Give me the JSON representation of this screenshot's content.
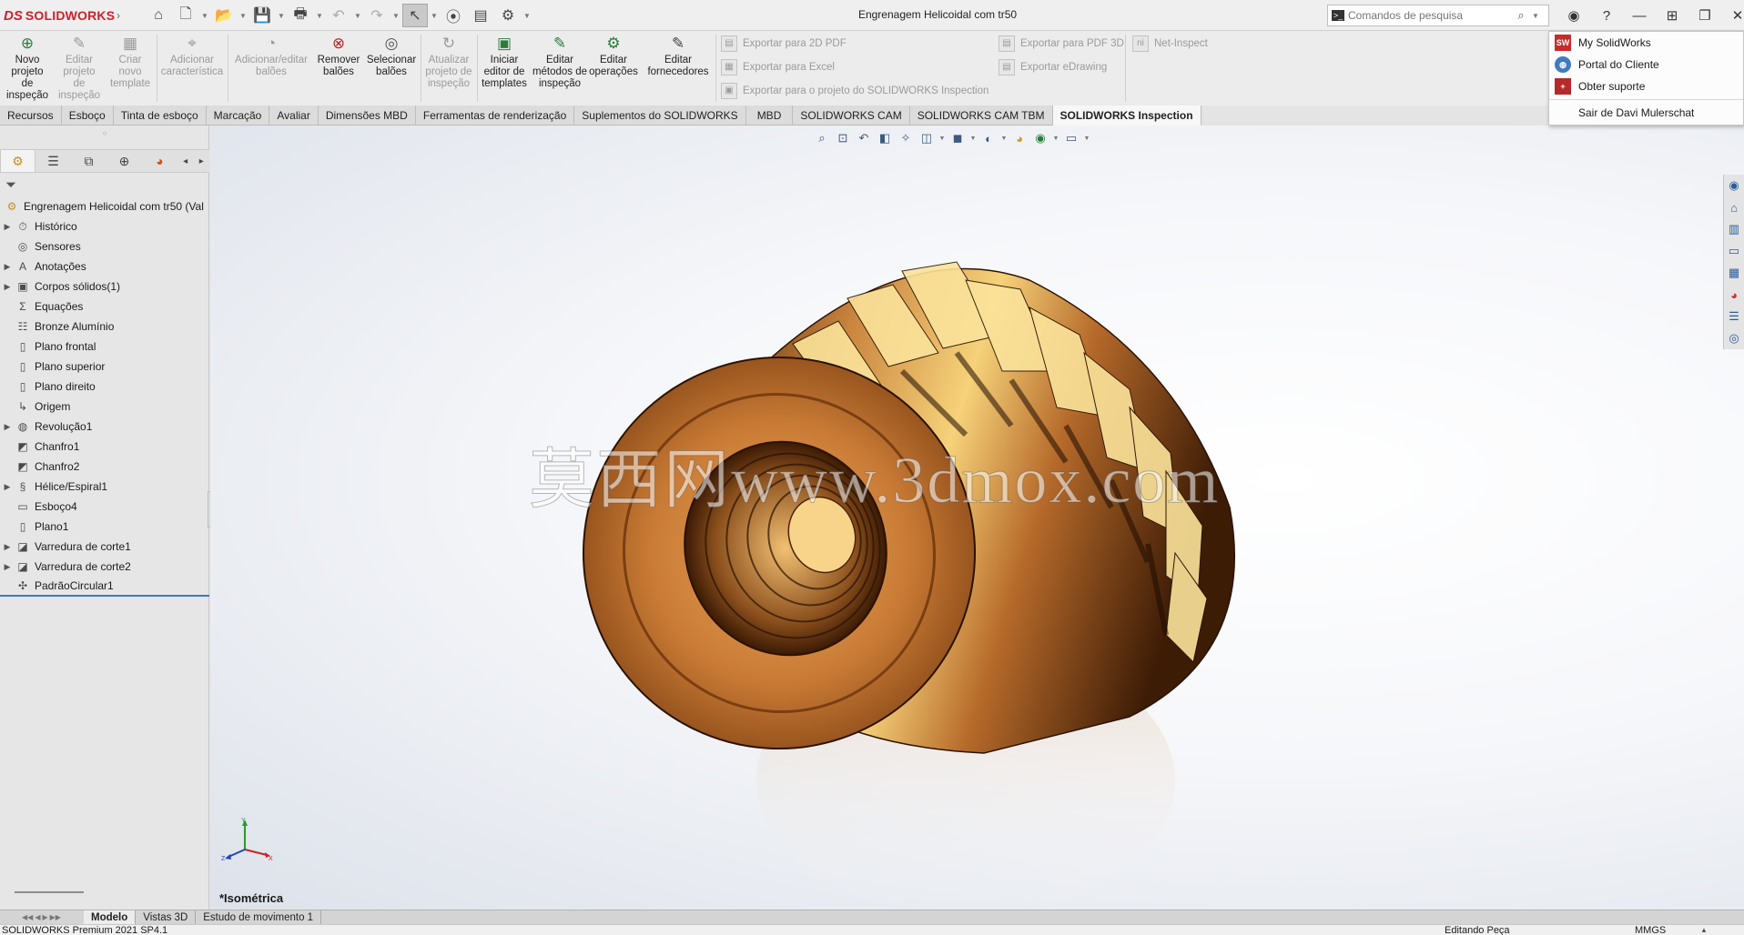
{
  "app": {
    "brand_ds": "DS",
    "brand_name": "SOLIDWORKS",
    "document_title": "Engrenagem Helicoidal com tr50"
  },
  "search": {
    "placeholder": "Comandos de pesquisa",
    "icon": "search-icon"
  },
  "ribbon": {
    "buttons": [
      {
        "label": "Novo projeto de inspeção",
        "enabled": true
      },
      {
        "label": "Editar projeto de inspeção",
        "enabled": false
      },
      {
        "label": "Criar novo template",
        "enabled": false
      },
      {
        "label": "Adicionar característica",
        "enabled": false
      },
      {
        "label": "Adicionar/editar balões",
        "enabled": false
      },
      {
        "label": "Remover balões",
        "enabled": true
      },
      {
        "label": "Selecionar balões",
        "enabled": true
      },
      {
        "label": "Atualizar projeto de inspeção",
        "enabled": false
      },
      {
        "label": "Iniciar editor de templates",
        "enabled": true
      },
      {
        "label": "Editar métodos de inspeção",
        "enabled": true
      },
      {
        "label": "Editar operações",
        "enabled": true
      },
      {
        "label": "Editar fornecedores",
        "enabled": true
      }
    ],
    "exports": [
      {
        "label": "Exportar para 2D PDF"
      },
      {
        "label": "Exportar para Excel"
      },
      {
        "label": "Exportar para o projeto do SOLIDWORKS Inspection"
      },
      {
        "label": "Exportar para PDF 3D"
      },
      {
        "label": "Exportar eDrawing"
      },
      {
        "label": "Net-Inspect"
      }
    ]
  },
  "tabs": [
    {
      "label": "Recursos"
    },
    {
      "label": "Esboço"
    },
    {
      "label": "Tinta de esboço"
    },
    {
      "label": "Marcação"
    },
    {
      "label": "Avaliar"
    },
    {
      "label": "Dimensões MBD"
    },
    {
      "label": "Ferramentas de renderização"
    },
    {
      "label": "Suplementos do SOLIDWORKS"
    },
    {
      "label": "MBD"
    },
    {
      "label": "SOLIDWORKS CAM"
    },
    {
      "label": "SOLIDWORKS CAM TBM"
    },
    {
      "label": "SOLIDWORKS Inspection",
      "active": true
    }
  ],
  "tree": {
    "root": "Engrenagem Helicoidal com tr50  (Val",
    "items": [
      {
        "label": "Histórico",
        "expandable": true,
        "icon": "history-icon"
      },
      {
        "label": "Sensores",
        "expandable": false,
        "icon": "sensor-icon"
      },
      {
        "label": "Anotações",
        "expandable": true,
        "icon": "annotation-icon"
      },
      {
        "label": "Corpos sólidos(1)",
        "expandable": true,
        "icon": "solid-bodies-icon"
      },
      {
        "label": "Equações",
        "expandable": false,
        "icon": "equation-icon"
      },
      {
        "label": "Bronze Alumínio",
        "expandable": false,
        "icon": "material-icon"
      },
      {
        "label": "Plano frontal",
        "expandable": false,
        "icon": "plane-icon"
      },
      {
        "label": "Plano superior",
        "expandable": false,
        "icon": "plane-icon"
      },
      {
        "label": "Plano direito",
        "expandable": false,
        "icon": "plane-icon"
      },
      {
        "label": "Origem",
        "expandable": false,
        "icon": "origin-icon"
      },
      {
        "label": "Revolução1",
        "expandable": true,
        "icon": "revolve-icon"
      },
      {
        "label": "Chanfro1",
        "expandable": false,
        "icon": "chamfer-icon"
      },
      {
        "label": "Chanfro2",
        "expandable": false,
        "icon": "chamfer-icon"
      },
      {
        "label": "Hélice/Espiral1",
        "expandable": true,
        "icon": "helix-icon"
      },
      {
        "label": "Esboço4",
        "expandable": false,
        "icon": "sketch-icon"
      },
      {
        "label": "Plano1",
        "expandable": false,
        "icon": "plane-icon"
      },
      {
        "label": "Varredura de corte1",
        "expandable": true,
        "icon": "sweep-cut-icon"
      },
      {
        "label": "Varredura de corte2",
        "expandable": true,
        "icon": "sweep-cut-icon"
      },
      {
        "label": "PadrãoCircular1",
        "expandable": false,
        "icon": "circular-pattern-icon"
      }
    ]
  },
  "viewport": {
    "view_name": "*Isométrica",
    "watermark": "莫西网www.3dmox.com",
    "triad": {
      "x": "X",
      "y": "Y",
      "z": "Z"
    }
  },
  "help_menu": {
    "items": [
      {
        "label": "My SolidWorks",
        "icon": "mysw-icon"
      },
      {
        "label": "Portal do Cliente",
        "icon": "globe-icon"
      },
      {
        "label": "Obter suporte",
        "icon": "support-icon"
      },
      {
        "label": "Sair de Davi Mulerschat"
      }
    ]
  },
  "bottom_tabs": [
    {
      "label": "Modelo",
      "active": true
    },
    {
      "label": "Vistas 3D"
    },
    {
      "label": "Estudo de movimento 1"
    }
  ],
  "status": {
    "product": "SOLIDWORKS Premium 2021 SP4.1",
    "mode": "Editando Peça",
    "units": "MMGS"
  },
  "colors": {
    "brand": "#d0202b",
    "accent_line": "#3a78c8",
    "bronze": "#b87333"
  }
}
